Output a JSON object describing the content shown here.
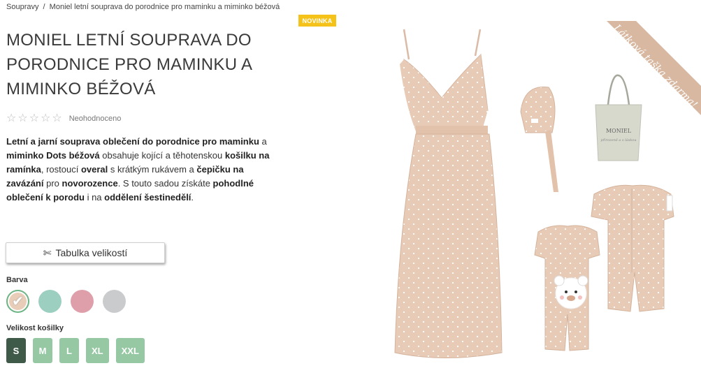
{
  "breadcrumb": {
    "items": [
      "Soupravy",
      "Moniel letní souprava do porodnice pro maminku a miminko béžová"
    ],
    "separator": "/"
  },
  "badge": "NOVINKA",
  "product": {
    "title": "MONIEL LETNÍ SOUPRAVA DO PORODNICE PRO MAMINKU A MIMINKO BÉŽOVÁ",
    "rating": {
      "stars": 0,
      "max": 5,
      "label": "Neohodnoceno"
    },
    "description": [
      {
        "t": "Letní a jarní souprava ",
        "b": true
      },
      {
        "t": "oblečení do porodnice pro maminku",
        "b": true
      },
      {
        "t": " a ",
        "b": false
      },
      {
        "t": "miminko Dots béžová",
        "b": true
      },
      {
        "t": " obsahuje kojící a těhotenskou ",
        "b": false
      },
      {
        "t": "košilku na ramínka",
        "b": true
      },
      {
        "t": ", rostoucí ",
        "b": false
      },
      {
        "t": "overal",
        "b": true
      },
      {
        "t": " s krátkým rukávem a ",
        "b": false
      },
      {
        "t": "čepičku na zavázání",
        "b": true
      },
      {
        "t": " pro ",
        "b": false
      },
      {
        "t": "novorozence",
        "b": true
      },
      {
        "t": ". S touto sadou získáte ",
        "b": false
      },
      {
        "t": "pohodlné oblečení k porodu",
        "b": true
      },
      {
        "t": " i na ",
        "b": false
      },
      {
        "t": "oddělení šestinedělí",
        "b": true
      },
      {
        "t": ".",
        "b": false
      }
    ]
  },
  "size_table_button": {
    "icon": "scissors-icon",
    "label": "Tabulka velikostí"
  },
  "color": {
    "label": "Barva",
    "options": [
      {
        "name": "béžová",
        "hex": "#e8cdb8",
        "selected": true
      },
      {
        "name": "mentolová",
        "hex": "#9ccfc0",
        "selected": false
      },
      {
        "name": "růžová",
        "hex": "#de9faa",
        "selected": false
      },
      {
        "name": "šedá",
        "hex": "#c9cbcd",
        "selected": false
      }
    ]
  },
  "size": {
    "label": "Velikost košilky",
    "options": [
      "S",
      "M",
      "L",
      "XL",
      "XXL"
    ],
    "selected": "S"
  },
  "image": {
    "banner": "Látková taška zdarma!",
    "bag_text": [
      "MONIEL",
      "přirozeně a s láskou"
    ]
  },
  "colors": {
    "badge": "#f5c21a",
    "size_button": "#96c8a4",
    "size_button_active": "#3f5a48",
    "fabric": "#e8cbb6",
    "banner": "#d8b8a1"
  }
}
